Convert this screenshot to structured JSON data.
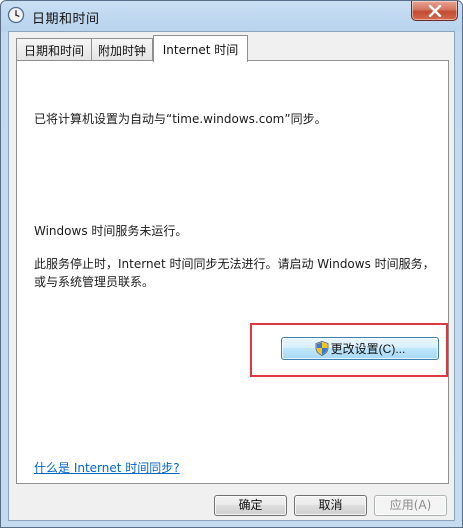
{
  "window": {
    "title": "日期和时间"
  },
  "tabs": [
    {
      "label": "日期和时间",
      "active": false
    },
    {
      "label": "附加时钟",
      "active": false
    },
    {
      "label": "Internet 时间",
      "active": true
    }
  ],
  "content": {
    "sync_text": "已将计算机设置为自动与“time.windows.com”同步。",
    "status_text": "Windows 时间服务未运行。",
    "message_line1": "此服务停止时，Internet 时间同步无法进行。请启动 Windows 时间服务，",
    "message_line2": "或与系统管理员联系。",
    "change_settings_label": "更改设置(C)...",
    "help_link": "什么是 Internet 时间同步?"
  },
  "buttons": {
    "ok": "确定",
    "cancel": "取消",
    "apply": "应用(A)"
  },
  "colors": {
    "highlight": "#e0363f",
    "link": "#0066cc",
    "titlebar": "#b8d3ee"
  },
  "icons": {
    "app": "clock-icon",
    "close": "close-icon",
    "uac": "shield-icon"
  }
}
